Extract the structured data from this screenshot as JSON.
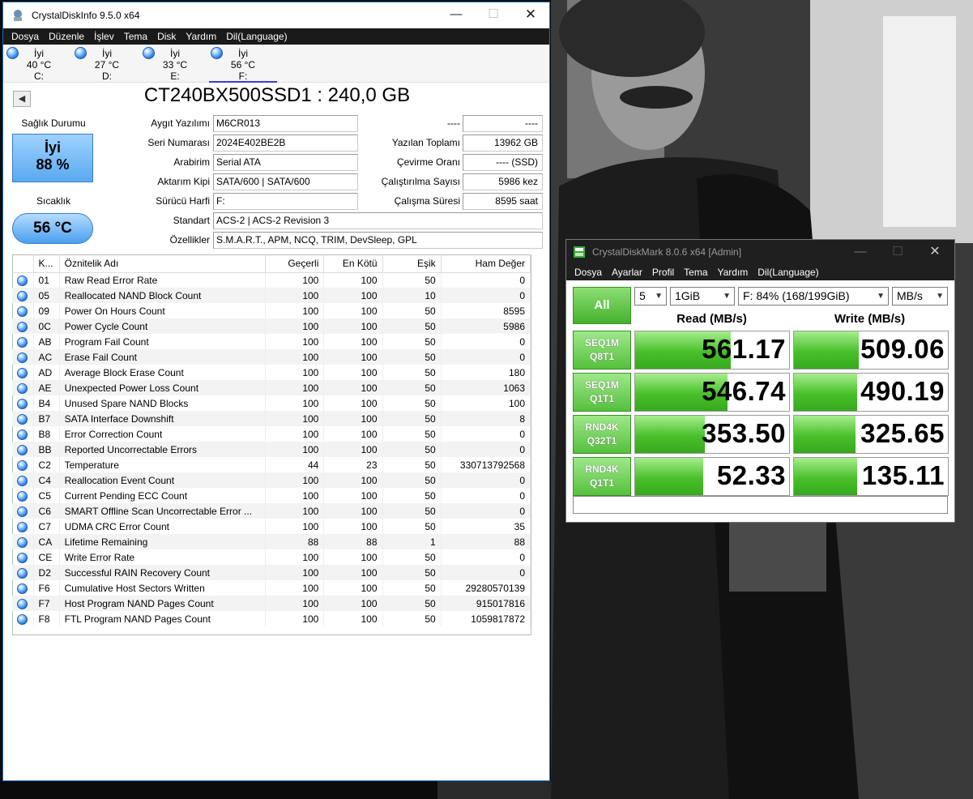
{
  "cdi": {
    "title": "CrystalDiskInfo 9.5.0 x64",
    "menu": [
      "Dosya",
      "Düzenle",
      "İşlev",
      "Tema",
      "Disk",
      "Yardım",
      "Dil(Language)"
    ],
    "drives": [
      {
        "status": "İyi",
        "temp": "40 °C",
        "letter": "C:"
      },
      {
        "status": "İyi",
        "temp": "27 °C",
        "letter": "D:"
      },
      {
        "status": "İyi",
        "temp": "33 °C",
        "letter": "E:"
      },
      {
        "status": "İyi",
        "temp": "56 °C",
        "letter": "F:"
      }
    ],
    "model": "CT240BX500SSD1 : 240,0 GB",
    "health_label": "Sağlık Durumu",
    "health_status": "İyi",
    "health_percent": "88 %",
    "temp_label": "Sıcaklık",
    "temp_value": "56 °C",
    "fields": {
      "firmware_label": "Aygıt Yazılımı",
      "firmware": "M6CR013",
      "serial_label": "Seri Numarası",
      "serial": "2024E402BE2B",
      "interface_label": "Arabirim",
      "interface": "Serial ATA",
      "transfer_label": "Aktarım Kipi",
      "transfer": "SATA/600 | SATA/600",
      "drive_label": "Sürücü Harfi",
      "drive": "F:",
      "standard_label": "Standart",
      "standard": "ACS-2 | ACS-2 Revision 3",
      "features_label": "Özellikler",
      "features": "S.M.A.R.T., APM, NCQ, TRIM, DevSleep, GPL",
      "r0_label": "----",
      "r0_value": "----",
      "writes_label": "Yazılan Toplamı",
      "writes": "13962 GB",
      "rotation_label": "Çevirme Oranı",
      "rotation": "---- (SSD)",
      "power_count_label": "Çalıştırılma Sayısı",
      "power_count": "5986 kez",
      "power_hours_label": "Çalışma Süresi",
      "power_hours": "8595 saat"
    },
    "table": {
      "headers": [
        "K...",
        "Öznitelik Adı",
        "Geçerli",
        "En Kötü",
        "Eşik",
        "Ham Değer"
      ],
      "rows": [
        [
          "01",
          "Raw Read Error Rate",
          "100",
          "100",
          "50",
          "0"
        ],
        [
          "05",
          "Reallocated NAND Block Count",
          "100",
          "100",
          "10",
          "0"
        ],
        [
          "09",
          "Power On Hours Count",
          "100",
          "100",
          "50",
          "8595"
        ],
        [
          "0C",
          "Power Cycle Count",
          "100",
          "100",
          "50",
          "5986"
        ],
        [
          "AB",
          "Program Fail Count",
          "100",
          "100",
          "50",
          "0"
        ],
        [
          "AC",
          "Erase Fail Count",
          "100",
          "100",
          "50",
          "0"
        ],
        [
          "AD",
          "Average Block Erase Count",
          "100",
          "100",
          "50",
          "180"
        ],
        [
          "AE",
          "Unexpected Power Loss Count",
          "100",
          "100",
          "50",
          "1063"
        ],
        [
          "B4",
          "Unused Spare NAND Blocks",
          "100",
          "100",
          "50",
          "100"
        ],
        [
          "B7",
          "SATA Interface Downshift",
          "100",
          "100",
          "50",
          "8"
        ],
        [
          "B8",
          "Error Correction Count",
          "100",
          "100",
          "50",
          "0"
        ],
        [
          "BB",
          "Reported Uncorrectable Errors",
          "100",
          "100",
          "50",
          "0"
        ],
        [
          "C2",
          "Temperature",
          "44",
          "23",
          "50",
          "330713792568"
        ],
        [
          "C4",
          "Reallocation Event Count",
          "100",
          "100",
          "50",
          "0"
        ],
        [
          "C5",
          "Current Pending ECC Count",
          "100",
          "100",
          "50",
          "0"
        ],
        [
          "C6",
          "SMART Offline Scan Uncorrectable Error ...",
          "100",
          "100",
          "50",
          "0"
        ],
        [
          "C7",
          "UDMA CRC Error Count",
          "100",
          "100",
          "50",
          "35"
        ],
        [
          "CA",
          "Lifetime Remaining",
          "88",
          "88",
          "1",
          "88"
        ],
        [
          "CE",
          "Write Error Rate",
          "100",
          "100",
          "50",
          "0"
        ],
        [
          "D2",
          "Successful RAIN Recovery Count",
          "100",
          "100",
          "50",
          "0"
        ],
        [
          "F6",
          "Cumulative Host Sectors Written",
          "100",
          "100",
          "50",
          "29280570139"
        ],
        [
          "F7",
          "Host Program NAND Pages Count",
          "100",
          "100",
          "50",
          "915017816"
        ],
        [
          "F8",
          "FTL Program NAND Pages Count",
          "100",
          "100",
          "50",
          "1059817872"
        ]
      ]
    }
  },
  "cdm": {
    "title": "CrystalDiskMark 8.0.6 x64 [Admin]",
    "menu": [
      "Dosya",
      "Ayarlar",
      "Profil",
      "Tema",
      "Yardım",
      "Dil(Language)"
    ],
    "all_label": "All",
    "count": "5",
    "size": "1GiB",
    "drive": "F: 84% (168/199GiB)",
    "unit": "MB/s",
    "read_header": "Read (MB/s)",
    "write_header": "Write (MB/s)",
    "tests": [
      {
        "l1": "SEQ1M",
        "l2": "Q8T1",
        "read": "561.17",
        "write": "509.06",
        "read_fill": 0.62,
        "write_fill": 0.42
      },
      {
        "l1": "SEQ1M",
        "l2": "Q1T1",
        "read": "546.74",
        "write": "490.19",
        "read_fill": 0.6,
        "write_fill": 0.41
      },
      {
        "l1": "RND4K",
        "l2": "Q32T1",
        "read": "353.50",
        "write": "325.65",
        "read_fill": 0.45,
        "write_fill": 0.4
      },
      {
        "l1": "RND4K",
        "l2": "Q1T1",
        "read": "52.33",
        "write": "135.11",
        "read_fill": 0.44,
        "write_fill": 0.41
      }
    ],
    "comment": ""
  }
}
